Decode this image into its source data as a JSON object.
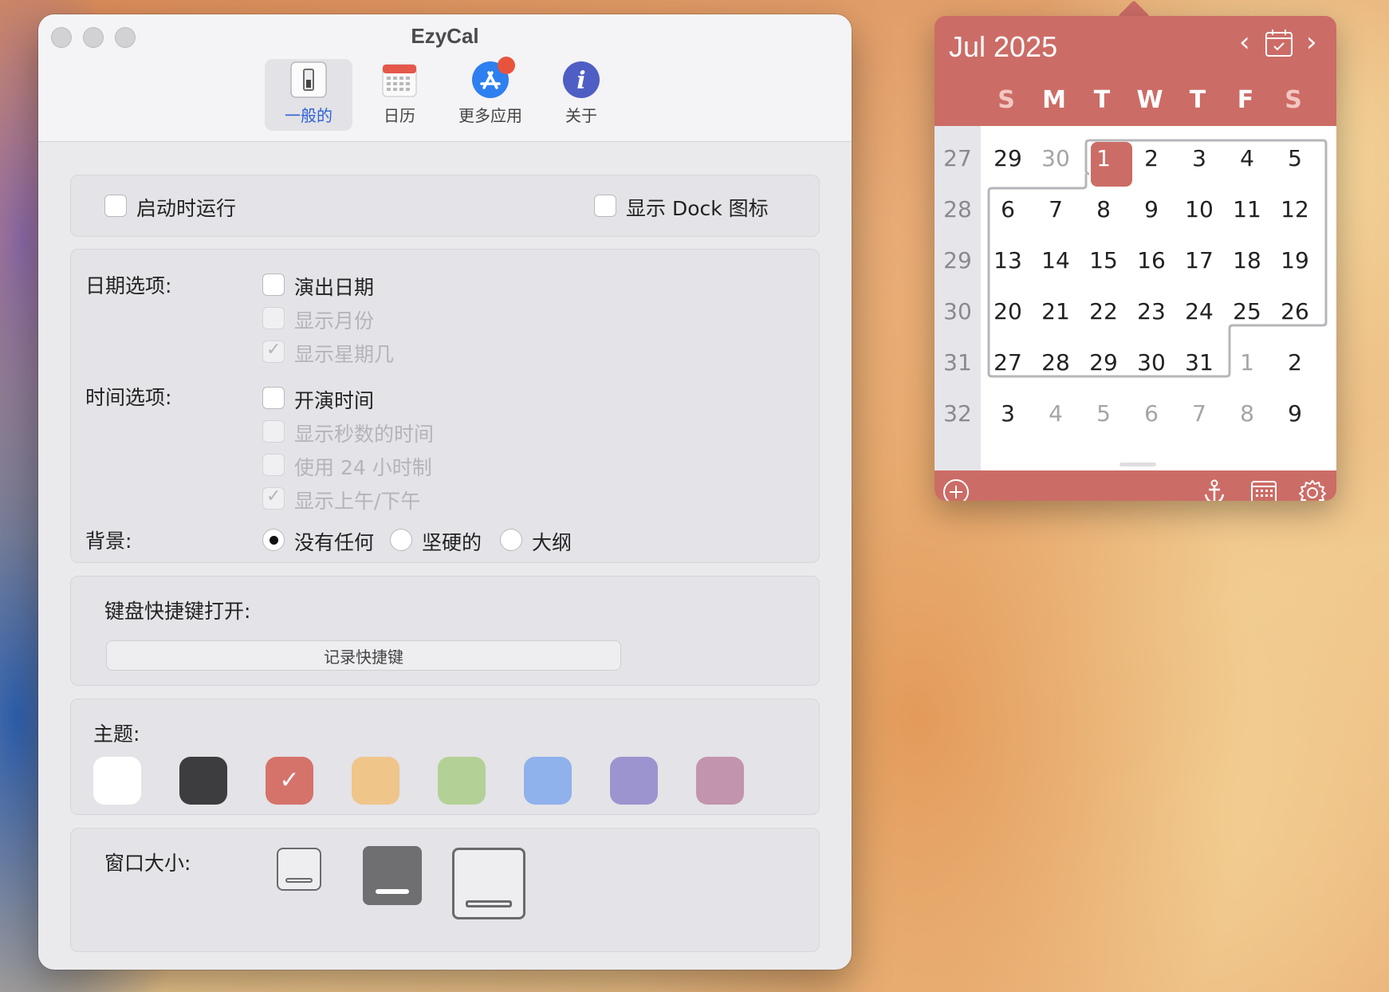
{
  "window": {
    "title": "EzyCal",
    "tabs": [
      {
        "label": "一般的",
        "icon": "switch-icon",
        "active": true
      },
      {
        "label": "日历",
        "icon": "calendar-icon",
        "active": false
      },
      {
        "label": "更多应用",
        "icon": "app-store-icon",
        "active": false,
        "badge": true
      },
      {
        "label": "关于",
        "icon": "info-icon",
        "active": false
      }
    ]
  },
  "general": {
    "launch_at_login": {
      "label": "启动时运行",
      "checked": false
    },
    "show_dock_icon": {
      "label": "显示 Dock 图标",
      "checked": false
    }
  },
  "date_options": {
    "label": "日期选项:",
    "items": [
      {
        "label": "演出日期",
        "checked": false,
        "enabled": true
      },
      {
        "label": "显示月份",
        "checked": false,
        "enabled": false
      },
      {
        "label": "显示星期几",
        "checked": true,
        "enabled": false
      }
    ]
  },
  "time_options": {
    "label": "时间选项:",
    "items": [
      {
        "label": "开演时间",
        "checked": false,
        "enabled": true
      },
      {
        "label": "显示秒数的时间",
        "checked": false,
        "enabled": false
      },
      {
        "label": "使用 24 小时制",
        "checked": false,
        "enabled": false
      },
      {
        "label": "显示上午/下午",
        "checked": true,
        "enabled": false
      }
    ]
  },
  "background": {
    "label": "背景:",
    "options": [
      "没有任何",
      "坚硬的",
      "大纲"
    ],
    "selected": "没有任何"
  },
  "shortcut": {
    "label": "键盘快捷键打开:",
    "button": "记录快捷键"
  },
  "theme": {
    "label": "主题:",
    "swatches": [
      "#ffffff",
      "#3d3d3f",
      "#d5736b",
      "#efc589",
      "#b3d196",
      "#8fb1ec",
      "#9c94ce",
      "#c394ad"
    ],
    "selected_index": 2
  },
  "window_size": {
    "label": "窗口大小:",
    "options": [
      "small",
      "medium",
      "large"
    ],
    "selected": "medium"
  },
  "calendar": {
    "month_label": "Jul 2025",
    "accent": "#cc6c66",
    "weekdays": [
      "S",
      "M",
      "T",
      "W",
      "T",
      "F",
      "S"
    ],
    "weeks": [
      {
        "num": "27",
        "days": [
          "29",
          "30",
          "1",
          "2",
          "3",
          "4",
          "5"
        ]
      },
      {
        "num": "28",
        "days": [
          "6",
          "7",
          "8",
          "9",
          "10",
          "11",
          "12"
        ]
      },
      {
        "num": "29",
        "days": [
          "13",
          "14",
          "15",
          "16",
          "17",
          "18",
          "19"
        ]
      },
      {
        "num": "30",
        "days": [
          "20",
          "21",
          "22",
          "23",
          "24",
          "25",
          "26"
        ]
      },
      {
        "num": "31",
        "days": [
          "27",
          "28",
          "29",
          "30",
          "31",
          "1",
          "2"
        ]
      },
      {
        "num": "32",
        "days": [
          "3",
          "4",
          "5",
          "6",
          "7",
          "8",
          "9"
        ]
      }
    ],
    "today": "1",
    "footer_icons": [
      "add-icon",
      "anchor-icon",
      "calendar-grid-icon",
      "gear-icon"
    ]
  }
}
